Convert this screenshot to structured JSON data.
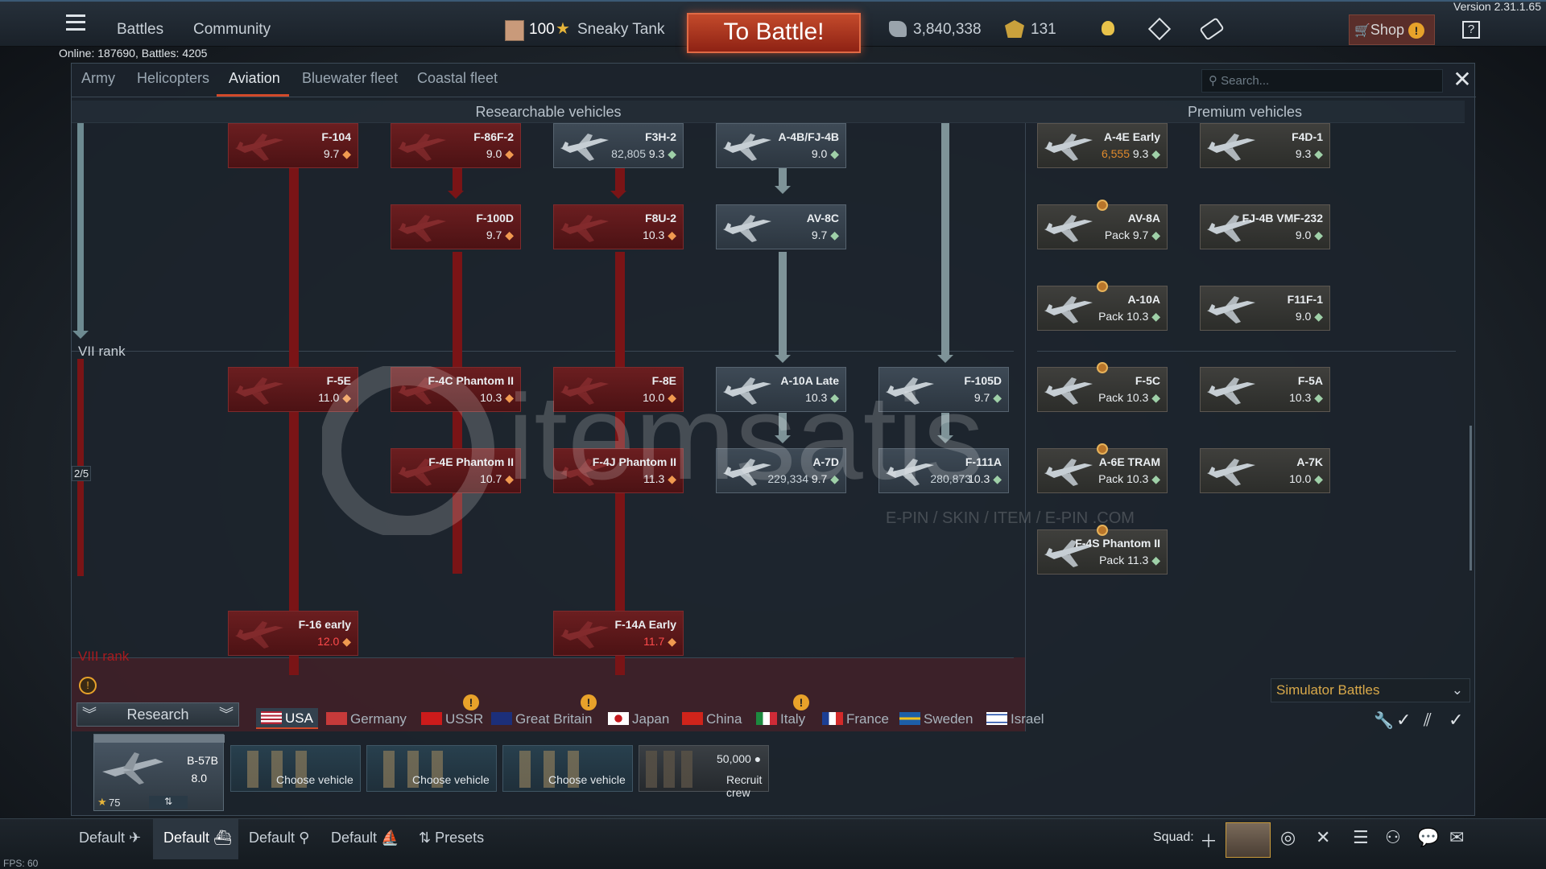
{
  "version": "Version 2.31.1.65",
  "topbar": {
    "battles": "Battles",
    "community": "Community",
    "player_level": "100",
    "player_name": "Sneaky Tank",
    "to_battle": "To Battle!",
    "silver_lions": "3,840,338",
    "golden_eagles": "131",
    "shop": "Shop"
  },
  "online": "Online: 187690, Battles: 4205",
  "tabs": [
    "Army",
    "Helicopters",
    "Aviation",
    "Bluewater fleet",
    "Coastal fleet"
  ],
  "search_placeholder": "Search...",
  "sections": {
    "researchable": "Researchable vehicles",
    "premium": "Premium vehicles"
  },
  "ranks": {
    "vii": "VII rank",
    "viii": "VIII rank",
    "progress": "2/5"
  },
  "tree": [
    {
      "name": "F-104",
      "br": "9.7",
      "style": "red"
    },
    {
      "name": "F-86F-2",
      "br": "9.0",
      "style": "red"
    },
    {
      "name": "F3H-2",
      "br": "9.3",
      "rp": "82,805",
      "style": "grey"
    },
    {
      "name": "A-4B/FJ-4B",
      "br": "9.0",
      "style": "grey"
    },
    {
      "name": "F-100D",
      "br": "9.7",
      "style": "red"
    },
    {
      "name": "F8U-2",
      "br": "10.3",
      "style": "red"
    },
    {
      "name": "AV-8C",
      "br": "9.7",
      "style": "grey"
    },
    {
      "name": "F-5E",
      "br": "11.0",
      "style": "red"
    },
    {
      "name": "F-4C Phantom II",
      "br": "10.3",
      "style": "red"
    },
    {
      "name": "F-8E",
      "br": "10.0",
      "style": "red"
    },
    {
      "name": "A-10A Late",
      "br": "10.3",
      "style": "grey"
    },
    {
      "name": "F-105D",
      "br": "9.7",
      "style": "grey"
    },
    {
      "name": "F-4E Phantom II",
      "br": "10.7",
      "style": "red"
    },
    {
      "name": "F-4J Phantom II",
      "br": "11.3",
      "style": "red"
    },
    {
      "name": "A-7D",
      "br": "9.7",
      "rp": "229,334",
      "style": "grey"
    },
    {
      "name": "F-111A",
      "br": "10.3",
      "rp": "280,873",
      "style": "grey"
    },
    {
      "name": "F-16 early",
      "br": "12.0",
      "style": "red"
    },
    {
      "name": "F-14A Early",
      "br": "11.7",
      "style": "red"
    }
  ],
  "premium": [
    {
      "name": "A-4E Early",
      "br": "9.3",
      "rp": "6,555"
    },
    {
      "name": "F4D-1",
      "br": "9.3"
    },
    {
      "name": "AV-8A",
      "br": "Pack 9.7"
    },
    {
      "name": "FJ-4B VMF-232",
      "br": "9.0"
    },
    {
      "name": "A-10A",
      "br": "Pack 10.3"
    },
    {
      "name": "F11F-1",
      "br": "9.0"
    },
    {
      "name": "F-5C",
      "br": "Pack 10.3"
    },
    {
      "name": "F-5A",
      "br": "10.3"
    },
    {
      "name": "A-6E TRAM",
      "br": "Pack 10.3"
    },
    {
      "name": "A-7K",
      "br": "10.0"
    },
    {
      "name": "F-4S Phantom II",
      "br": "Pack 11.3"
    }
  ],
  "mode": "Simulator Battles",
  "research": "Research",
  "countries": [
    "USA",
    "Germany",
    "USSR",
    "Great Britain",
    "Japan",
    "China",
    "Italy",
    "France",
    "Sweden",
    "Israel"
  ],
  "crew": {
    "vehicle": "B-57B",
    "vehicle_br": "8.0",
    "level": "75",
    "choose": "Choose vehicle",
    "recruit": "Recruit crew",
    "recruit_cost": "50,000"
  },
  "presets": [
    "Default",
    "Default",
    "Default",
    "Default",
    "Presets"
  ],
  "squad": "Squad:",
  "fps": "FPS: 60",
  "watermark": {
    "logo": "itemsatis",
    "sub": "E-PIN / SKIN / ITEM / E-PIN .COM"
  }
}
